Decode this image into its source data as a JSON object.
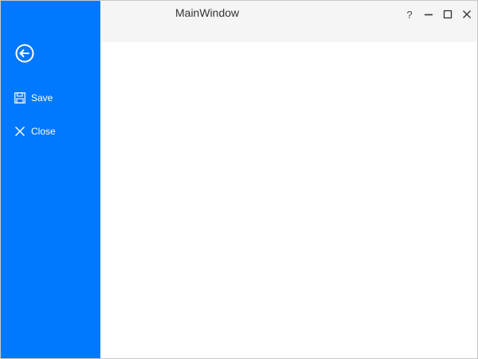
{
  "window": {
    "title": "MainWindow",
    "help_label": "?"
  },
  "backstage": {
    "background": "#0078ff",
    "back_icon": "arrow-left-circle-icon",
    "items": [
      {
        "label": "Save",
        "icon": "floppy-disk-icon"
      },
      {
        "label": "Close",
        "icon": "x-close-icon"
      }
    ]
  },
  "caption_buttons": [
    "help",
    "minimize",
    "maximize",
    "close"
  ]
}
